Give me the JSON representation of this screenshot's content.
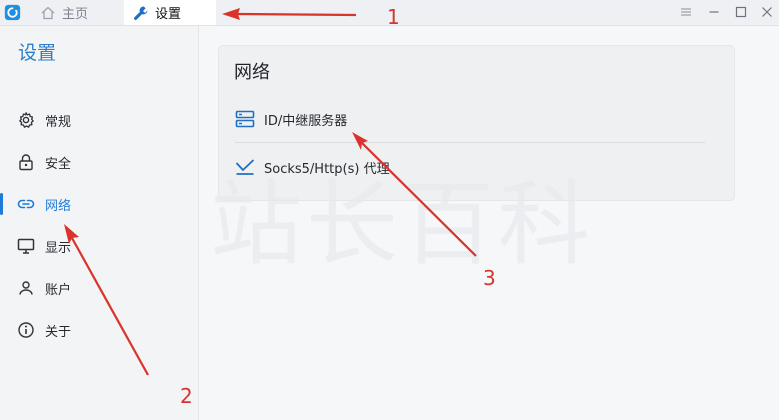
{
  "titlebar": {
    "tabs": [
      {
        "label": "主页",
        "icon": "home-icon"
      },
      {
        "label": "设置",
        "icon": "wrench-icon"
      }
    ],
    "controls": [
      "menu-icon",
      "minimize-icon",
      "maximize-icon",
      "close-icon"
    ]
  },
  "sidebar": {
    "title": "设置",
    "items": [
      {
        "label": "常规",
        "icon": "gear-icon"
      },
      {
        "label": "安全",
        "icon": "lock-icon"
      },
      {
        "label": "网络",
        "icon": "link-icon",
        "active": true
      },
      {
        "label": "显示",
        "icon": "monitor-icon"
      },
      {
        "label": "账户",
        "icon": "user-icon"
      },
      {
        "label": "关于",
        "icon": "info-icon"
      }
    ]
  },
  "main": {
    "card": {
      "title": "网络",
      "options": [
        {
          "label": "ID/中继服务器",
          "icon": "server-icon"
        },
        {
          "label": "Socks5/Http(s) 代理",
          "icon": "proxy-icon"
        }
      ]
    }
  },
  "watermark": "站长百科",
  "annotations": {
    "steps": [
      "1",
      "2",
      "3"
    ],
    "color": "#d9332b"
  },
  "colors": {
    "accent": "#1f7bd8",
    "sidebar_bg": "#f3f4f6",
    "card_bg": "#eff0f2"
  }
}
